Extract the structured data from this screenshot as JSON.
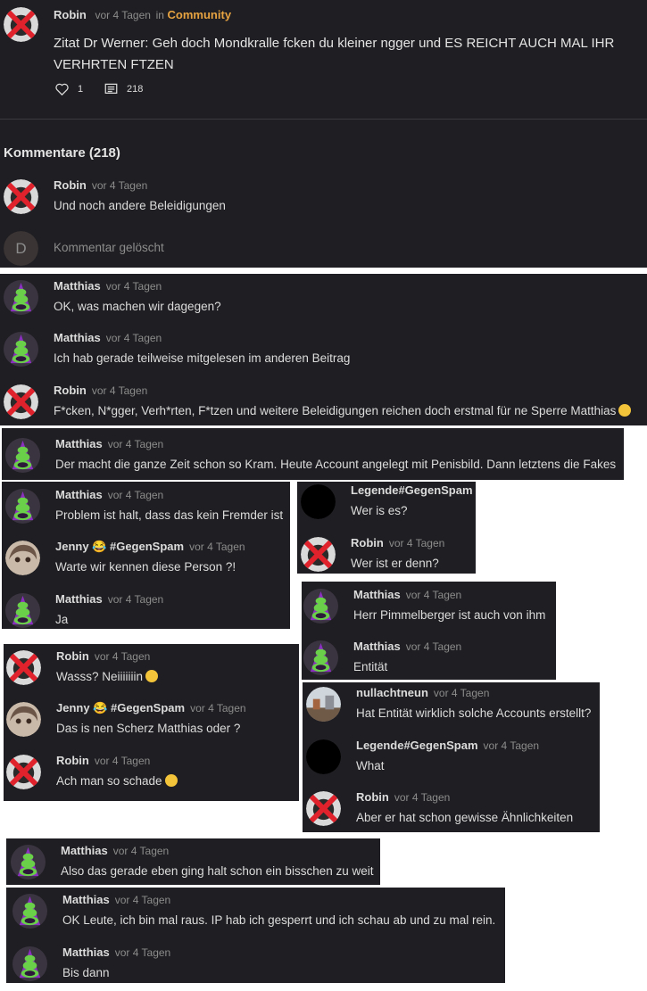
{
  "post": {
    "author": "Robin",
    "time": "vor 4 Tagen",
    "in_label": "in",
    "community": "Community",
    "text": "Zitat Dr Werner: Geh doch Mondkralle fcken du kleiner ngger und ES REICHT AUCH MAL IHR VERHRTEN FTZEN",
    "likes": "1",
    "comments": "218"
  },
  "comments_heading": "Kommentare (218)",
  "comments": [
    {
      "author": "Robin",
      "time": "vor 4 Tagen",
      "text": "Und noch andere Beleidigungen",
      "avatar": "robin-avatar"
    },
    {
      "author": "",
      "time": "",
      "text": "Kommentar gelöscht",
      "avatar": "deleted-avatar",
      "initial": "D"
    },
    {
      "author": "Matthias",
      "time": "vor 4 Tagen",
      "text": "OK, was machen wir dagegen?",
      "avatar": "matthias-avatar"
    },
    {
      "author": "Matthias",
      "time": "vor 4 Tagen",
      "text": "Ich hab gerade teilweise mitgelesen im anderen Beitrag",
      "avatar": "matthias-avatar"
    },
    {
      "author": "Robin",
      "time": "vor 4 Tagen",
      "text": "F*cken, N*gger, Verh*rten, F*tzen und weitere Beleidigungen reichen doch erstmal für ne Sperre Matthias",
      "avatar": "robin-avatar",
      "emoji": "wink-emoji"
    },
    {
      "author": "Matthias",
      "time": "vor 4 Tagen",
      "text": "Der macht die ganze Zeit schon so Kram. Heute Account angelegt mit Penisbild. Dann letztens die Fakes",
      "avatar": "matthias-avatar"
    },
    {
      "author": "Matthias",
      "time": "vor 4 Tagen",
      "text": "Problem ist halt, dass das kein Fremder ist",
      "avatar": "matthias-avatar"
    },
    {
      "author": "Jenny 😂 #GegenSpam",
      "time": "vor 4 Tagen",
      "text": "Warte wir kennen diese Person ?!",
      "avatar": "jenny-avatar"
    },
    {
      "author": "Matthias",
      "time": "vor 4 Tagen",
      "text": "Ja",
      "avatar": "matthias-avatar"
    },
    {
      "author": "Legende#GegenSpam",
      "time": "",
      "text": "Wer is es?",
      "avatar": "legende-avatar"
    },
    {
      "author": "Robin",
      "time": "vor 4 Tagen",
      "text": "Wer ist er denn?",
      "avatar": "robin-avatar"
    },
    {
      "author": "Matthias",
      "time": "vor 4 Tagen",
      "text": "Herr Pimmelberger ist auch von ihm",
      "avatar": "matthias-avatar"
    },
    {
      "author": "Matthias",
      "time": "vor 4 Tagen",
      "text": "Entität",
      "avatar": "matthias-avatar"
    },
    {
      "author": "Robin",
      "time": "vor 4 Tagen",
      "text": "Wasss? Neiiiiiiin",
      "avatar": "robin-avatar",
      "emoji": "scream-emoji"
    },
    {
      "author": "Jenny 😂 #GegenSpam",
      "time": "vor 4 Tagen",
      "text": "Das is nen Scherz Matthias oder ?",
      "avatar": "jenny-avatar"
    },
    {
      "author": "Robin",
      "time": "vor 4 Tagen",
      "text": "Ach man so schade",
      "avatar": "robin-avatar",
      "emoji": "sad-emoji"
    },
    {
      "author": "nullachtneun",
      "time": "vor 4 Tagen",
      "text": "Hat Entität wirklich solche Accounts erstellt?",
      "avatar": "nullachtneun-avatar"
    },
    {
      "author": "Legende#GegenSpam",
      "time": "vor 4 Tagen",
      "text": "What",
      "avatar": "legende-avatar"
    },
    {
      "author": "Robin",
      "time": "vor 4 Tagen",
      "text": "Aber er hat schon gewisse Ähnlichkeiten",
      "avatar": "robin-avatar"
    },
    {
      "author": "Matthias",
      "time": "vor 4 Tagen",
      "text": "Also das gerade eben ging halt schon ein bisschen zu weit",
      "avatar": "matthias-avatar"
    },
    {
      "author": "Matthias",
      "time": "vor 4 Tagen",
      "text": "OK Leute, ich bin mal raus. IP hab ich gesperrt und ich schau ab und zu mal rein.",
      "avatar": "matthias-avatar"
    },
    {
      "author": "Matthias",
      "time": "vor 4 Tagen",
      "text": "Bis dann",
      "avatar": "matthias-avatar"
    }
  ],
  "colors": {
    "panel": "#1f1e22",
    "accent": "#e7a341",
    "text": "#dcdcdc",
    "muted": "#8c8c8c"
  }
}
